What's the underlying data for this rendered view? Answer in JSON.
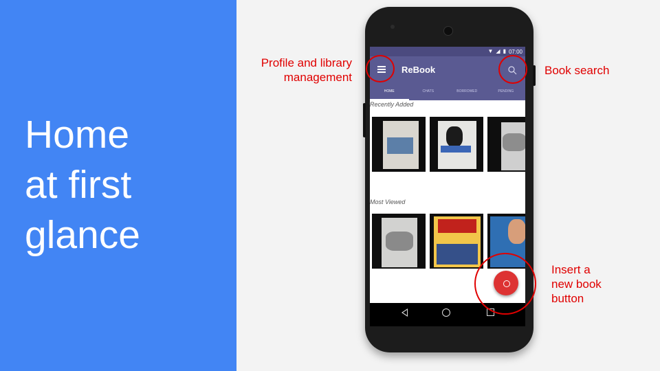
{
  "slide": {
    "title_lines": [
      "Home",
      "at first",
      "glance"
    ]
  },
  "app": {
    "status_time": "07:00",
    "title": "ReBook",
    "tabs": [
      "HOME",
      "CHATS",
      "BORROWED",
      "PENDING"
    ],
    "active_tab": "HOME",
    "sections": {
      "recently_added": "Recently Added",
      "most_viewed": "Most Viewed"
    }
  },
  "annotations": {
    "profile": [
      "Profile and library",
      "management"
    ],
    "search": "Book search",
    "insert": [
      "Insert a",
      "new book",
      "button"
    ]
  },
  "colors": {
    "left_panel": "#4285f4",
    "app_bar": "#5a5a92",
    "annotation": "#e00000",
    "fab": "#dd3333"
  }
}
